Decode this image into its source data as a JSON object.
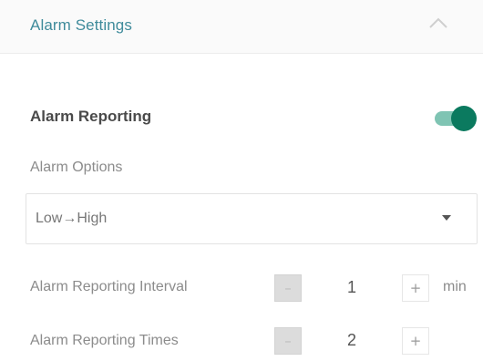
{
  "panel": {
    "title": "Alarm Settings",
    "collapse_icon": "chevron-up-icon"
  },
  "alarm_reporting": {
    "label": "Alarm Reporting",
    "enabled": true,
    "toggle_color": "#0b7a5f"
  },
  "alarm_options": {
    "label": "Alarm Options",
    "selected": "Low→High",
    "dropdown_icon": "caret-down-icon"
  },
  "reporting_interval": {
    "label": "Alarm Reporting Interval",
    "minus": "–",
    "value": "1",
    "plus": "+",
    "unit": "min"
  },
  "reporting_times": {
    "label": "Alarm Reporting Times",
    "minus": "–",
    "value": "2",
    "plus": "+"
  }
}
